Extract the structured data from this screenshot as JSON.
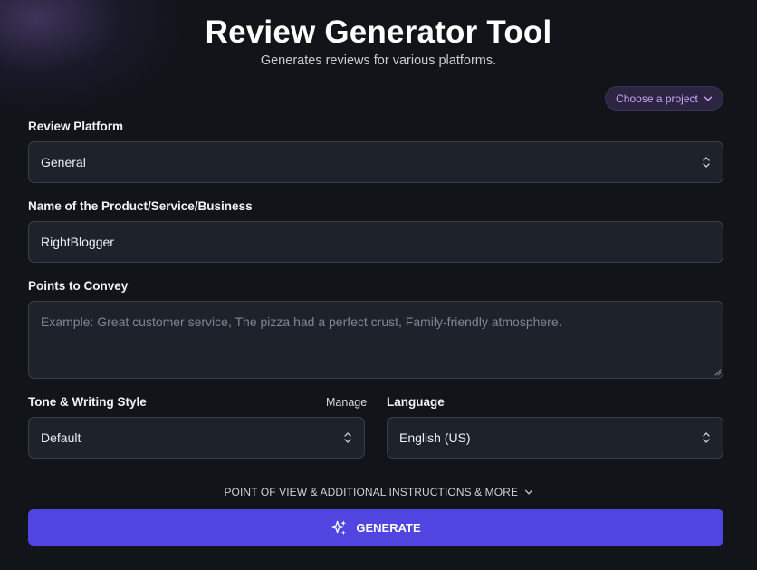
{
  "header": {
    "title": "Review Generator Tool",
    "subtitle": "Generates reviews for various platforms."
  },
  "project_selector": {
    "label": "Choose a project",
    "icon": "chevron-down-icon"
  },
  "form": {
    "platform": {
      "label": "Review Platform",
      "value": "General"
    },
    "product_name": {
      "label": "Name of the Product/Service/Business",
      "value": "RightBlogger"
    },
    "points": {
      "label": "Points to Convey",
      "value": "",
      "placeholder": "Example: Great customer service, The pizza had a perfect crust, Family-friendly atmosphere."
    },
    "tone": {
      "label": "Tone & Writing Style",
      "manage_label": "Manage",
      "value": "Default"
    },
    "language": {
      "label": "Language",
      "value": "English (US)"
    }
  },
  "more_options": {
    "label": "POINT OF VIEW & ADDITIONAL INSTRUCTIONS & MORE"
  },
  "generate_button": {
    "label": "GENERATE",
    "icon": "sparkles-icon"
  },
  "colors": {
    "background": "#111419",
    "field_bg": "#1d222b",
    "accent": "#5045e0",
    "project_text": "#c9a3f5"
  }
}
